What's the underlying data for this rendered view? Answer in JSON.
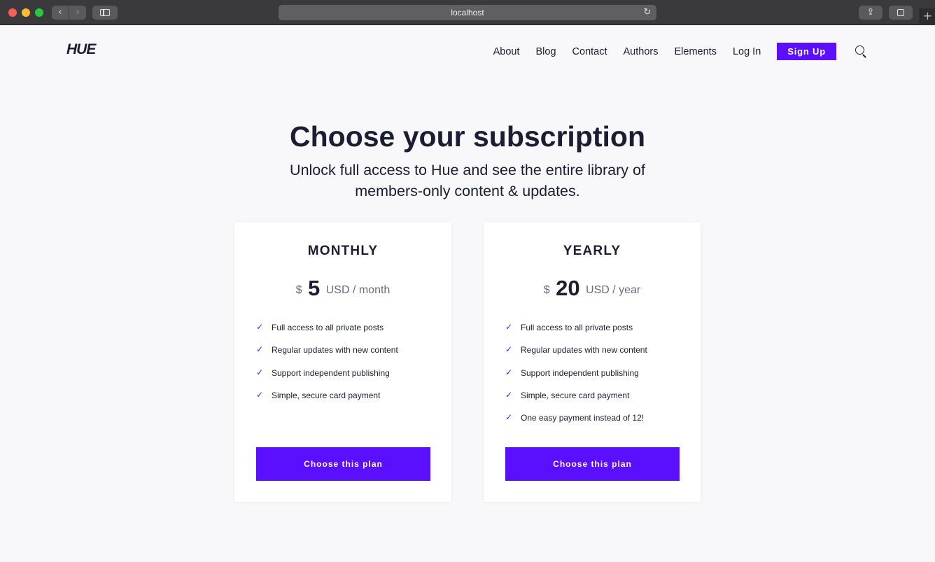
{
  "browser": {
    "url": "localhost",
    "back_icon": "chevron-left-icon",
    "forward_icon": "chevron-right-icon",
    "reload_icon": "reload-icon",
    "new_tab_label": "+"
  },
  "site": {
    "logo": "HUE",
    "nav": [
      "About",
      "Blog",
      "Contact",
      "Authors",
      "Elements",
      "Log In"
    ],
    "signup_label": "Sign Up",
    "accent_color": "#5a10ff"
  },
  "hero": {
    "title": "Choose your subscription",
    "subtitle": "Unlock full access to Hue and see the entire library of members-only content & updates."
  },
  "plans": [
    {
      "name": "MONTHLY",
      "currency": "$",
      "amount": "5",
      "period": "USD / month",
      "features": [
        "Full access to all private posts",
        "Regular updates with new content",
        "Support independent publishing",
        "Simple, secure card payment"
      ],
      "button_label": "Choose this plan"
    },
    {
      "name": "YEARLY",
      "currency": "$",
      "amount": "20",
      "period": "USD / year",
      "features": [
        "Full access to all private posts",
        "Regular updates with new content",
        "Support independent publishing",
        "Simple, secure card payment",
        "One easy payment instead of 12!"
      ],
      "button_label": "Choose this plan"
    }
  ]
}
